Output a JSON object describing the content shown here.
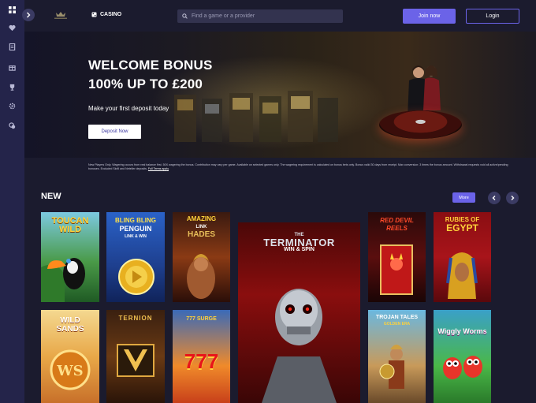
{
  "header": {
    "casino_label": "CASINO",
    "search_placeholder": "Find a game or a provider",
    "join_label": "Join now",
    "login_label": "Login"
  },
  "sidebar": {
    "icons": [
      "grid-icon",
      "heart-icon",
      "document-icon",
      "gift-icon",
      "trophy-icon",
      "settings-icon",
      "chat-icon"
    ]
  },
  "hero": {
    "title_line1": "WELCOME BONUS",
    "title_line2": "100% UP TO £200",
    "subtitle": "Make your first deposit today",
    "cta_label": "Deposit Now"
  },
  "terms": {
    "text": "New Players Only. Wagering occurs from real balance first. 50X wagering the bonus. Contribution may vary per game. Available on selected games only. The wagering requirement is calculated on bonus bets only. Bonus valid 30 days from receipt. Max conversion: 3 times the bonus amount. Withdrawal requests void all active/pending bonuses. Excluded Skrill and Neteller deposits.",
    "link": "Full Terms apply"
  },
  "new_section": {
    "title": "NEW",
    "more_label": "More",
    "games": [
      {
        "line1": "TOUCAN",
        "line2": "WILD"
      },
      {
        "line1": "BLING BLING",
        "line2": "PENGUIN",
        "line3": "LINK & WIN"
      },
      {
        "line1": "AMAZING",
        "line2": "LINK",
        "line3": "HADES"
      },
      {
        "line1": "THE",
        "line2": "TERMINATOR",
        "line3": "WIN & SPIN"
      },
      {
        "line1": "RED DEVIL",
        "line2": "REELS"
      },
      {
        "line1": "RUBIES OF",
        "line2": "EGYPT"
      },
      {
        "line1": "WILD",
        "line2": "SANDS"
      },
      {
        "line1": "TERNION"
      },
      {
        "line1": "777 SURGE",
        "line2": "777"
      },
      {
        "line1": "TROJAN TALES",
        "line2": "GOLDEN ERA"
      },
      {
        "line1": "Wiggly Worms"
      }
    ]
  },
  "colors": {
    "accent": "#6b63e8",
    "sidebar": "#24244a",
    "background": "#1b1b2e"
  }
}
